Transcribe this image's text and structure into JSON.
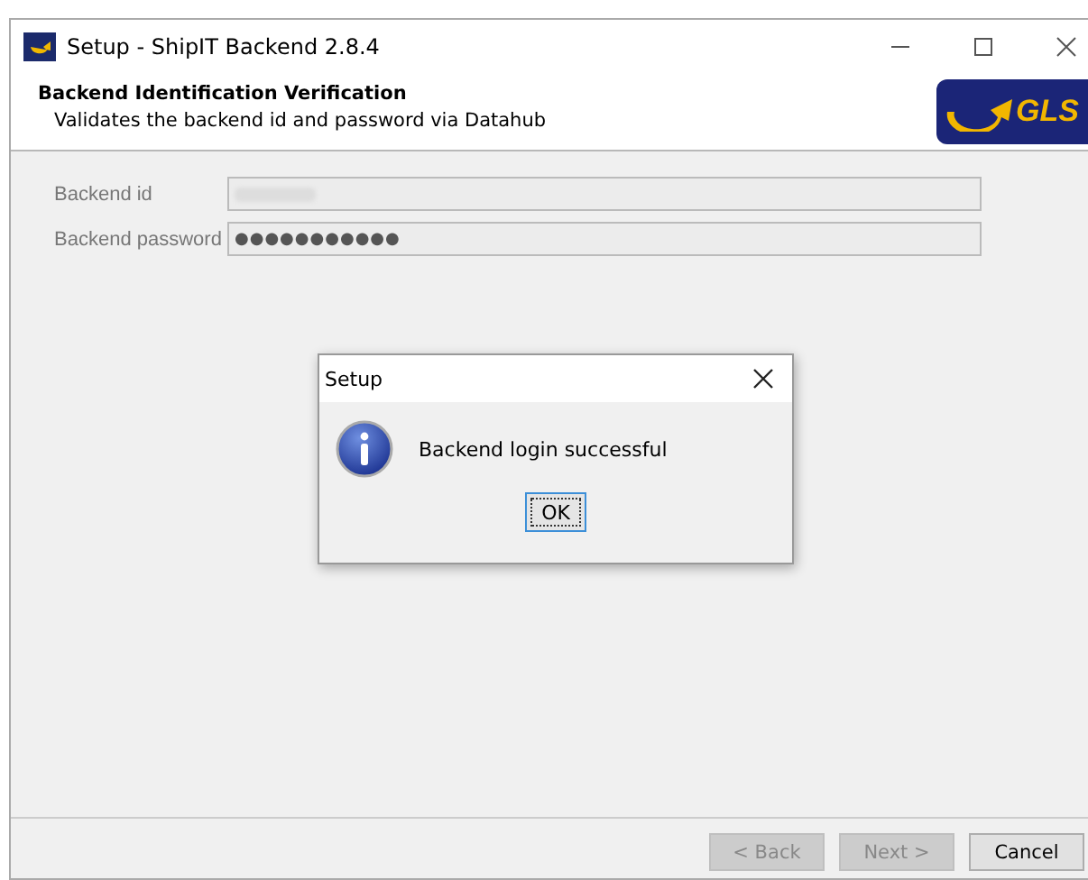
{
  "window": {
    "title": "Setup - ShipIT Backend 2.8.4"
  },
  "header": {
    "title": "Backend Identification Verification",
    "subtitle": "Validates the backend id and password via Datahub",
    "logo": "GLS"
  },
  "fields": [
    {
      "label": "Backend id",
      "kind": "redacted"
    },
    {
      "label": "Backend password",
      "kind": "password",
      "value": "●●●●●●●●●●●"
    }
  ],
  "dialog": {
    "title": "Setup",
    "message": "Backend login successful",
    "button": "OK"
  },
  "buttons": [
    {
      "label": "< Back",
      "disabled": true
    },
    {
      "label": "Next >",
      "disabled": true
    },
    {
      "label": "Cancel",
      "disabled": false
    }
  ]
}
